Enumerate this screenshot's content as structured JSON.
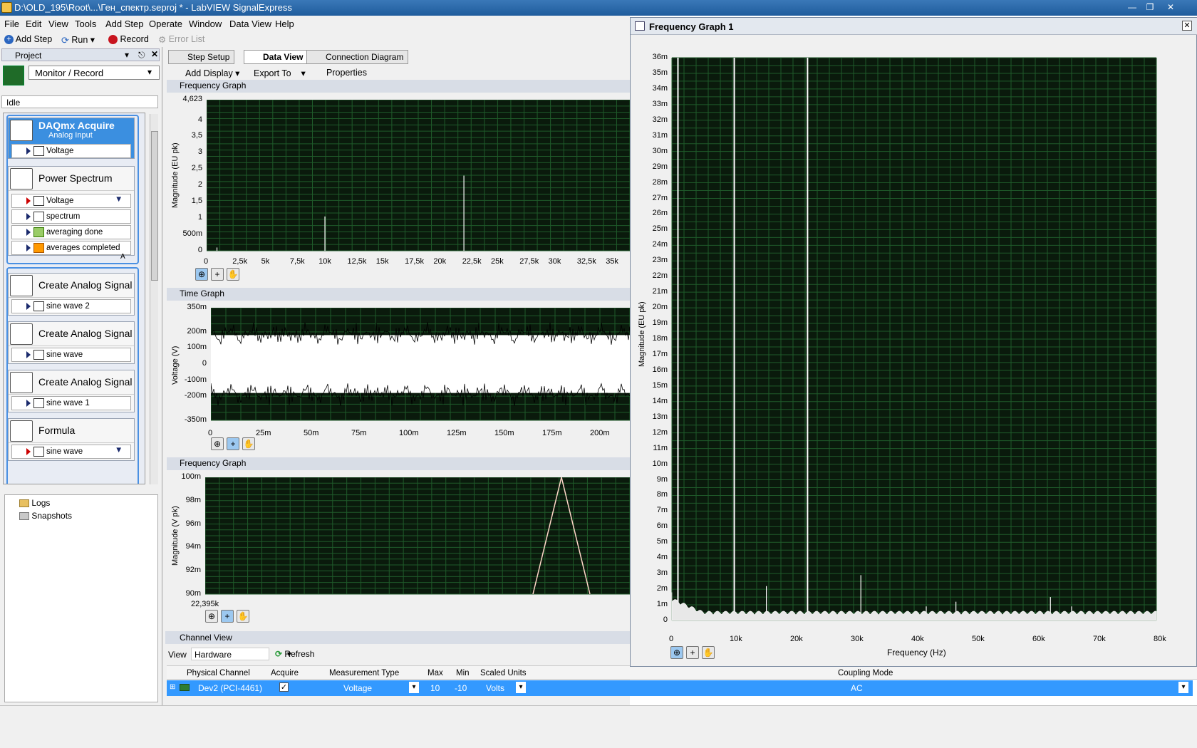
{
  "window": {
    "title": "D:\\OLD_195\\Root\\...\\Ген_спектр.seproj * - LabVIEW SignalExpress"
  },
  "menu": [
    "File",
    "Edit",
    "View",
    "Tools",
    "Add Step",
    "Operate",
    "Window",
    "Data View",
    "Help"
  ],
  "toolbar": {
    "add_step": "Add Step",
    "run": "Run",
    "record": "Record",
    "error_list": "Error List"
  },
  "project": {
    "title": "Project",
    "mode": "Monitor / Record",
    "status": "Idle",
    "steps": [
      {
        "title": "DAQmx Acquire",
        "subtitle": "Analog Input",
        "rows": [
          "Voltage"
        ]
      },
      {
        "title": "Power Spectrum",
        "rows": [
          "Voltage",
          "spectrum",
          "averaging done",
          "averages completed"
        ]
      },
      {
        "title": "Create Analog Signal",
        "rows": [
          "sine wave 2"
        ]
      },
      {
        "title": "Create Analog Signal",
        "rows": [
          "sine wave"
        ]
      },
      {
        "title": "Create Analog Signal",
        "rows": [
          "sine wave 1"
        ]
      },
      {
        "title": "Formula",
        "rows": [
          "sine wave"
        ]
      }
    ],
    "tree": [
      "Logs",
      "Snapshots"
    ],
    "marker": "A"
  },
  "tabs": [
    "Step Setup",
    "Data View",
    "Connection Diagram"
  ],
  "dataview_toolbar": {
    "add_display": "Add Display",
    "export_to": "Export To",
    "properties": "Properties"
  },
  "graphs": {
    "freq1": {
      "title": "Frequency Graph",
      "ylabel": "Magnitude (EU pk)",
      "yticks": [
        "4,623",
        "4",
        "3,5",
        "3",
        "2,5",
        "2",
        "1,5",
        "1",
        "500m",
        "0"
      ],
      "xticks": [
        "0",
        "2,5k",
        "5k",
        "7,5k",
        "10k",
        "12,5k",
        "15k",
        "17,5k",
        "20k",
        "22,5k",
        "25k",
        "27,5k",
        "30k",
        "32,5k",
        "35k"
      ]
    },
    "time": {
      "title": "Time Graph",
      "ylabel": "Voltage (V)",
      "yticks": [
        "350m",
        "200m",
        "100m",
        "0",
        "-100m",
        "-200m",
        "-350m"
      ],
      "xticks": [
        "0",
        "25m",
        "50m",
        "75m",
        "100m",
        "125m",
        "150m",
        "175m",
        "200m"
      ]
    },
    "freq2": {
      "title": "Frequency Graph",
      "ylabel": "Magnitude (V pk)",
      "yticks": [
        "100m",
        "98m",
        "96m",
        "94m",
        "92m",
        "90m"
      ],
      "xtick": "22,395k"
    },
    "big": {
      "title": "Frequency Graph 1",
      "ylabel": "Magnitude (EU pk)",
      "xlabel": "Frequency (Hz)",
      "yticks": [
        "36m",
        "35m",
        "34m",
        "33m",
        "32m",
        "31m",
        "30m",
        "29m",
        "28m",
        "27m",
        "26m",
        "25m",
        "24m",
        "23m",
        "22m",
        "21m",
        "20m",
        "19m",
        "18m",
        "17m",
        "16m",
        "15m",
        "14m",
        "13m",
        "12m",
        "11m",
        "10m",
        "9m",
        "8m",
        "7m",
        "6m",
        "5m",
        "4m",
        "3m",
        "2m",
        "1m",
        "0"
      ],
      "xticks": [
        "0",
        "10k",
        "20k",
        "30k",
        "40k",
        "50k",
        "60k",
        "70k",
        "80k"
      ]
    }
  },
  "channel_view": {
    "title": "Channel View",
    "view_label": "View",
    "view_value": "Hardware",
    "refresh": "Refresh",
    "headers": [
      "Physical Channel",
      "Acquire",
      "Measurement Type",
      "Max",
      "Min",
      "Scaled Units",
      "Coupling Mode"
    ],
    "row": {
      "channel": "Dev2 (PCI-4461)",
      "measurement": "Voltage",
      "max": "10",
      "min": "-10",
      "units": "Volts",
      "coupling": "AC"
    }
  },
  "colors": {
    "graph_bg": "#0a1a0c",
    "grid": "#1f5a2a",
    "trace": "#ffffff",
    "selected_row": "#3399ff"
  }
}
